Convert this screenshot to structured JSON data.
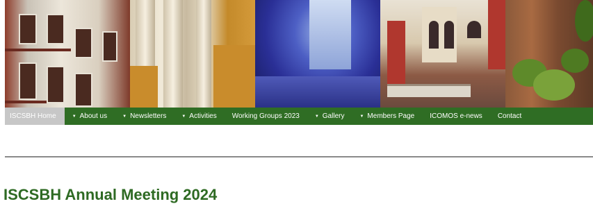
{
  "nav": {
    "items": [
      {
        "label": "ISCSBH Home",
        "dropdown": false,
        "active": true
      },
      {
        "label": "About us",
        "dropdown": true,
        "active": false
      },
      {
        "label": "Newsletters",
        "dropdown": true,
        "active": false
      },
      {
        "label": "Activities",
        "dropdown": true,
        "active": false
      },
      {
        "label": "Working Groups 2023",
        "dropdown": false,
        "active": false
      },
      {
        "label": "Gallery",
        "dropdown": true,
        "active": false
      },
      {
        "label": "Members Page",
        "dropdown": true,
        "active": false
      },
      {
        "label": "ICOMOS e-news",
        "dropdown": false,
        "active": false
      },
      {
        "label": "Contact",
        "dropdown": false,
        "active": false
      }
    ],
    "caret_icon": "caret-down-icon"
  },
  "main": {
    "title": "ISCSBH Annual Meeting 2024"
  },
  "colors": {
    "nav_background": "#2f6d24",
    "nav_active_background": "#c7c7c7",
    "title_color": "#2e6a23",
    "divider": "#8a8a8a"
  }
}
